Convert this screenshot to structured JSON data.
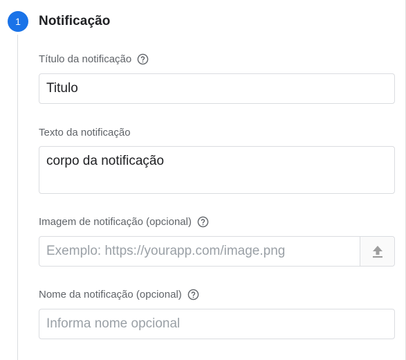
{
  "step": {
    "number": "1",
    "title": "Notificação",
    "accent_color": "#1a73e8"
  },
  "fields": {
    "title": {
      "label": "Título da notificação",
      "value": "Titulo",
      "help_icon": "help-circle-icon"
    },
    "text": {
      "label": "Texto da notificação",
      "value": "corpo da notificação"
    },
    "image": {
      "label": "Imagem de notificação (opcional)",
      "placeholder": "Exemplo: https://yourapp.com/image.png",
      "help_icon": "help-circle-icon",
      "upload_icon": "upload-icon"
    },
    "name": {
      "label": "Nome da notificação (opcional)",
      "placeholder": "Informa nome opcional",
      "help_icon": "help-circle-icon"
    }
  }
}
